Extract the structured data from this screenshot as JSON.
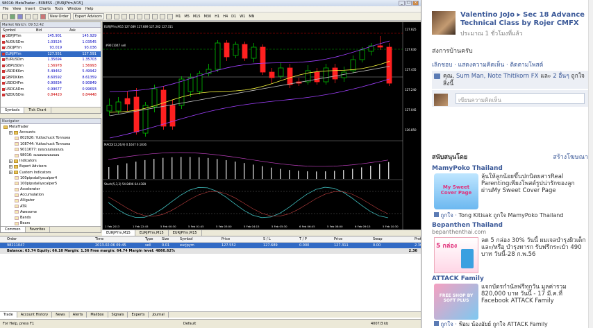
{
  "mt": {
    "title": "98016: MetaTrader - EXNESS - [EURJPYm,M15]",
    "menu": [
      "File",
      "View",
      "Insert",
      "Charts",
      "Tools",
      "Window",
      "Help"
    ],
    "toolbar": {
      "new_order": "New Order",
      "expert_advisors": "Expert Advisors",
      "timeframes": [
        "M1",
        "M5",
        "M15",
        "M30",
        "H1",
        "H4",
        "D1",
        "W1",
        "MN"
      ]
    },
    "market_watch": {
      "title": "Market Watch: 09:52:42",
      "headers": [
        "Symbol",
        "Bid",
        "Ask"
      ],
      "rows": [
        {
          "sym": "GBPJPYm",
          "bid": "145.901",
          "ask": "145.929"
        },
        {
          "sym": "AUDUSDm",
          "bid": "1.03524",
          "ask": "1.03545"
        },
        {
          "sym": "USDJPYm",
          "bid": "93.019",
          "ask": "93.036"
        },
        {
          "sym": "EURJPYm",
          "bid": "127.551",
          "ask": "127.591"
        },
        {
          "sym": "EURUSDm",
          "bid": "1.35694",
          "ask": "1.35703"
        },
        {
          "sym": "GBPUSDm",
          "bid": "1.56978",
          "ask": "1.56993"
        },
        {
          "sym": "USDDKKm",
          "bid": "5.49462",
          "ask": "5.49942"
        },
        {
          "sym": "GBPDKKm",
          "bid": "8.60592",
          "ask": "8.61359"
        },
        {
          "sym": "USDCHFm",
          "bid": "0.90834",
          "ask": "0.90849"
        },
        {
          "sym": "USDCADm",
          "bid": "0.99677",
          "ask": "0.99693"
        },
        {
          "sym": "NZDUSDm",
          "bid": "0.84420",
          "ask": "0.84448"
        }
      ],
      "tabs": [
        "Symbols",
        "Tick Chart"
      ]
    },
    "navigator": {
      "title": "Navigator",
      "items": [
        {
          "label": "MetaTrader",
          "level": 0
        },
        {
          "label": "Accounts",
          "level": 1
        },
        {
          "label": "802926: Yuttachuck Tonnuea",
          "level": 2
        },
        {
          "label": "108744: Yuttachuck Tonnuea",
          "level": 2
        },
        {
          "label": "9011677: ณณณณณณณณ",
          "level": 2
        },
        {
          "label": "98016: ณณณณณณณณ",
          "level": 2
        },
        {
          "label": "Indicators",
          "level": 1
        },
        {
          "label": "Expert Advisors",
          "level": 1
        },
        {
          "label": "Custom Indicators",
          "level": 1
        },
        {
          "label": "100pipsdailyscalper4",
          "level": 2
        },
        {
          "label": "100pipsdailyscalper5",
          "level": 2
        },
        {
          "label": "Accelerator",
          "level": 2
        },
        {
          "label": "Accumulation",
          "level": 2
        },
        {
          "label": "Alligator",
          "level": 2
        },
        {
          "label": "ATR",
          "level": 2
        },
        {
          "label": "Awesome",
          "level": 2
        },
        {
          "label": "Bands",
          "level": 2
        },
        {
          "label": "Bears",
          "level": 2
        }
      ],
      "tabs": [
        "Common",
        "Favorites"
      ]
    },
    "chart": {
      "title": "EURJPYm,M15  127.689 127.689 127.262 127.311",
      "order_label": "#9011047 sell",
      "macd_label": "MACD(12,26,9) 0.1647 0.1836",
      "stoch_label": "Stoch(5,3,3) 54.8496 64.4389",
      "price_scale": [
        "127.825",
        "127.630",
        "127.435",
        "127.240",
        "127.045",
        "126.850"
      ],
      "time_labels": [
        "1 Feb 2013",
        "1 Feb 22:45",
        "5 Feb 00:30",
        "5 Feb 01:45",
        "5 Feb 03:00",
        "5 Feb 04:15",
        "5 Feb 05:30",
        "6 Feb 06:45",
        "5 Feb 08:00",
        "6 Feb 09:15",
        "5 Feb 10:30"
      ],
      "tabs": [
        "EURJPYm,M15",
        "EURJPYm,M15",
        "EURJPYm,M15"
      ]
    },
    "terminal": {
      "headers": [
        "Order",
        "Time",
        "Type",
        "Size",
        "Symbol",
        "Price",
        "S / L",
        "T / P",
        "Price",
        "Swap",
        "Profit"
      ],
      "order": {
        "order": "98211047",
        "time": "2013.02.06 09:45",
        "type": "sell",
        "size": "0.01",
        "symbol": "eurjpym",
        "price": "127.552",
        "sl": "127.689",
        "tp": "0.000",
        "cur": "127.311",
        "swap": "0.00",
        "profit": "2.36"
      },
      "balance": "Balance: 63.74  Equity: 66.10  Margin: 1.36  Free margin: 64.74  Margin level: 4860.62%",
      "balance_profit": "2.36",
      "tabs": [
        "Trade",
        "Account History",
        "News",
        "Alerts",
        "Mailbox",
        "Signals",
        "Experts",
        "Journal"
      ]
    },
    "status": {
      "left": "For Help, press F1",
      "default": "Default",
      "conn": "4007/3 kb"
    }
  },
  "fb": {
    "name": "Valentino JoJo ",
    "arrow": "▸",
    "group": "Sec 18 Advance Technical Class by Rojer CMFX",
    "time": "ประมาณ 1 ชั่วโมงที่แล้ว",
    "post": "ส่งการบ้านครับ",
    "actions": "เลิกชอบ · แสดงความคิดเห็น · ติดตามโพสต์",
    "likes_prefix": "คุณ, ",
    "likes_names": "Sum Man, Note Thitikorn FX",
    "likes_and": " และ ",
    "likes_others": "2 อื่นๆ",
    "likes_suffix": " ถูกใจสิ่งนี้",
    "comment_placeholder": "เขียนความคิดเห็น",
    "sponsored": "สนับสนุนโดย",
    "create_ad": "สร้างโฆษณา",
    "ads": [
      {
        "title": "MamyPoko Thailand",
        "url": "",
        "text": "ลุ้นให้ลูกน้อยขึ้นปกนิตยสารReal Parentingเพียงโพสต์รูปน่ารักของลูกผ่านMy Sweet Cover Page",
        "img_text": "My Sweet Cover Page",
        "like_pre": "ถูกใจ · ",
        "like_text": "Tong Kitisak ถูกใจ MamyPoko Thailand"
      },
      {
        "title": "Bepanthen Thailand",
        "url": "bepanthenthai.com",
        "text": "ลด 5 กล่อง 30% วันนี้ ผมเจลบำรุงผิวเด็ก และ/หรือ บำรุงทารก รับฟรีกระเป๋า 490 บาท วันนี้-28 ก.พ.56",
        "img_text": "5 กล่อง",
        "like_pre": "",
        "like_text": ""
      },
      {
        "title": "ATTACK Family",
        "url": "",
        "text": "แจกบัตรกำนัลฟรีทุกวัน มูลค่ารวม 820,000 บาท วันนี้ - 17 มี.ค.ที่ Facebook ATTACK Family",
        "img_text": "FREE SHOP BY SOFT PLUS",
        "like_pre": "ถูกใจ · ",
        "like_text": "ฟ้อม น้องอัยย์ ถูกใจ ATTACK Family"
      }
    ]
  },
  "colors": {
    "bull": "#00c000",
    "bear": "#ff2020",
    "chart_bg": "#000000",
    "fb_link": "#3b5998",
    "select": "#316ac5"
  }
}
